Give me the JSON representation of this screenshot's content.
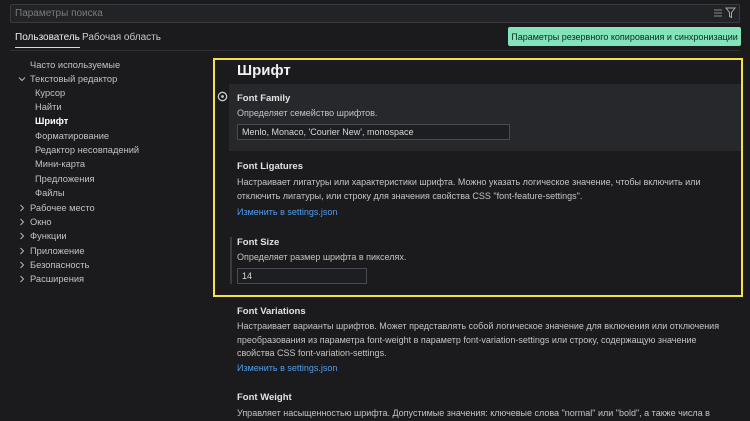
{
  "search": {
    "placeholder": "Параметры поиска"
  },
  "tabs": [
    {
      "label": "Пользователь"
    },
    {
      "label": "Рабочая область"
    }
  ],
  "backup_button": "Параметры резервного копирования и синхронизации",
  "toc": {
    "common": "Часто используемые",
    "text_editor": "Текстовый редактор",
    "cursor": "Курсор",
    "find": "Найти",
    "font": "Шрифт",
    "formatting": "Форматирование",
    "diff_editor": "Редактор несовпадений",
    "minimap": "Мини-карта",
    "suggestions": "Предложения",
    "files": "Файлы",
    "workbench": "Рабочее место",
    "window": "Окно",
    "features": "Функции",
    "application": "Приложение",
    "security": "Безопасность",
    "extensions": "Расширения"
  },
  "section_title": "Шрифт",
  "settings": {
    "font_family": {
      "title": "Font Family",
      "desc": "Определяет семейство шрифтов.",
      "value": "Menlo, Monaco, 'Courier New', monospace"
    },
    "font_ligatures": {
      "title": "Font Ligatures",
      "desc": "Настраивает лигатуры или характеристики шрифта. Можно указать логическое значение, чтобы включить или отключить лигатуры, или строку для значения свойства CSS \"font-feature-settings\".",
      "link": "Изменить в settings.json"
    },
    "font_size": {
      "title": "Font Size",
      "desc": "Определяет размер шрифта в пикселях.",
      "value": "14"
    },
    "font_variations": {
      "title": "Font Variations",
      "desc": "Настраивает варианты шрифтов. Может представлять собой логическое значение для включения или отключения преобразования из параметра font-weight в параметр font-variation-settings или строку, содержащую значение свойства CSS font-variation-settings.",
      "link": "Изменить в settings.json"
    },
    "font_weight": {
      "title": "Font Weight",
      "desc": "Управляет насыщенностью шрифта. Допустимые значения: ключевые слова \"normal\" или \"bold\", а также числа в"
    }
  },
  "colors": {
    "highlight_border": "#f3e24a",
    "backup_button_bg": "#83e3ba",
    "link": "#4f9eef"
  }
}
